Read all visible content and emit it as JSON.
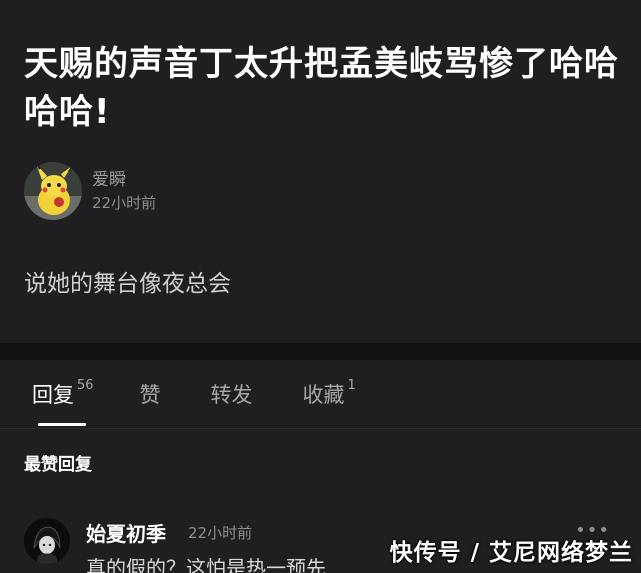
{
  "post": {
    "title": "天赐的声音丁太升把孟美岐骂惨了哈哈哈哈!",
    "author_name": "爱瞬",
    "author_time": "22小时前",
    "content": "说她的舞台像夜总会"
  },
  "tabs": [
    {
      "label": "回复",
      "count": "56",
      "active": true
    },
    {
      "label": "赞",
      "count": "",
      "active": false
    },
    {
      "label": "转发",
      "count": "",
      "active": false
    },
    {
      "label": "收藏",
      "count": "1",
      "active": false
    }
  ],
  "section_head": "最赞回复",
  "comment": {
    "name": "始夏初季",
    "time": "22小时前",
    "more": "•••",
    "text": "真的假的？这怕是热一预先"
  },
  "watermark": "快传号 / 艾尼网络梦兰",
  "icons": {
    "back": "chevron-left-icon",
    "more": "more-dots-icon"
  }
}
